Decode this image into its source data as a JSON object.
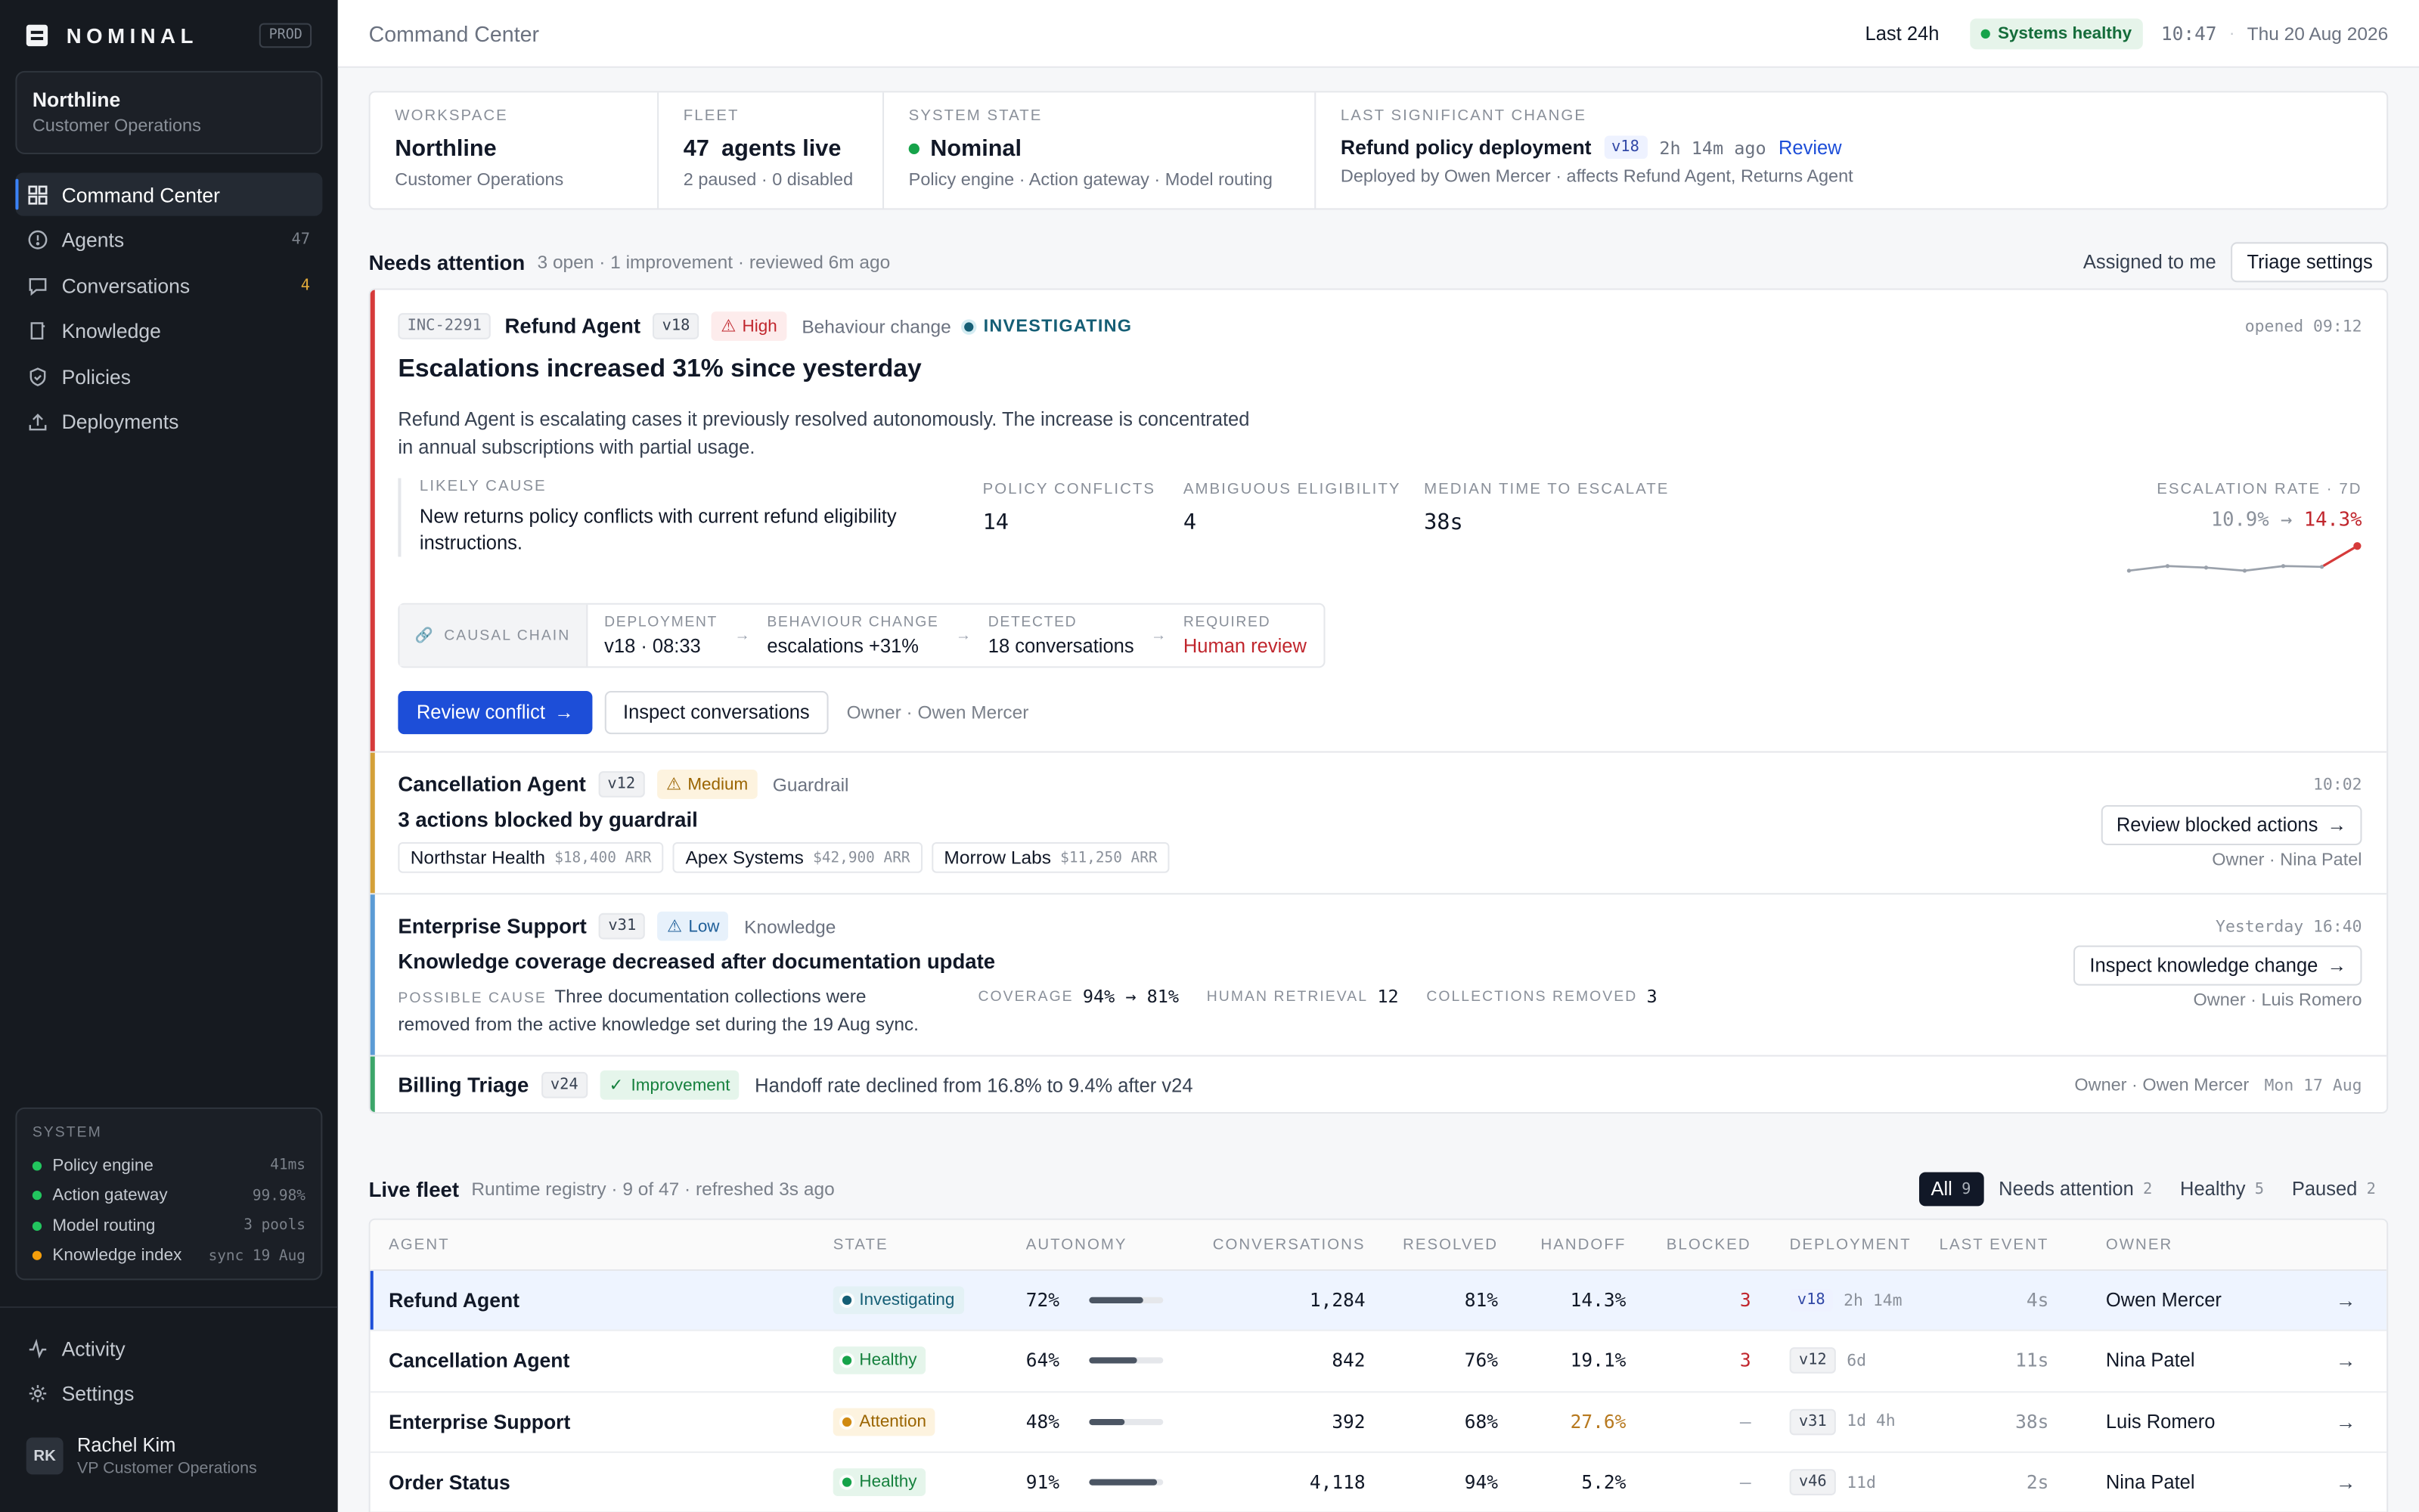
{
  "brand": {
    "name": "NOMINAL",
    "env": "PROD"
  },
  "workspace_card": {
    "name": "Northline",
    "sub": "Customer Operations"
  },
  "nav": [
    {
      "label": "Command Center",
      "icon": "grid-icon",
      "count": ""
    },
    {
      "label": "Agents",
      "icon": "agent-hex-icon",
      "count": "47"
    },
    {
      "label": "Conversations",
      "icon": "chat-icon",
      "count": "4"
    },
    {
      "label": "Knowledge",
      "icon": "book-icon",
      "count": ""
    },
    {
      "label": "Policies",
      "icon": "shield-icon",
      "count": ""
    },
    {
      "label": "Deployments",
      "icon": "upload-icon",
      "count": ""
    }
  ],
  "system": {
    "title": "SYSTEM",
    "rows": [
      {
        "label": "Policy engine",
        "value": "41ms",
        "color": "#22c55e"
      },
      {
        "label": "Action gateway",
        "value": "99.98%",
        "color": "#22c55e"
      },
      {
        "label": "Model routing",
        "value": "3 pools",
        "color": "#22c55e"
      },
      {
        "label": "Knowledge index",
        "value": "sync 19 Aug",
        "color": "#f59e0b"
      }
    ]
  },
  "side_bottom": {
    "activity": "Activity",
    "settings": "Settings"
  },
  "user": {
    "initials": "RK",
    "name": "Rachel Kim",
    "role": "VP Customer Operations"
  },
  "topbar": {
    "title": "Command Center",
    "range": "Last 24h",
    "health": "Systems healthy",
    "time": "10:47",
    "sep": "·",
    "date": "Thu 20 Aug 2026"
  },
  "summary": {
    "workspace": {
      "label": "WORKSPACE",
      "value": "Northline",
      "sub": "Customer Operations"
    },
    "fleet": {
      "label": "FLEET",
      "count": "47",
      "value": "agents live",
      "sub": "2 paused · 0 disabled"
    },
    "state": {
      "label": "SYSTEM STATE",
      "value": "Nominal",
      "sub": "Policy engine · Action gateway · Model routing"
    },
    "change": {
      "label": "LAST SIGNIFICANT CHANGE",
      "value": "Refund policy deployment",
      "version": "v18",
      "ago": "2h 14m ago",
      "link": "Review",
      "sub": "Deployed by Owen Mercer · affects Refund Agent, Returns Agent"
    }
  },
  "attention": {
    "title": "Needs attention",
    "subtitle": "3 open · 1 improvement · reviewed 6m ago",
    "assigned": "Assigned to me",
    "settings": "Triage settings"
  },
  "incident1": {
    "id": "INC-2291",
    "agent": "Refund Agent",
    "version": "v18",
    "severity": "High",
    "kind": "Behaviour change",
    "status": "INVESTIGATING",
    "opened": "opened 09:12",
    "title": "Escalations increased 31% since yesterday",
    "desc1": "Refund Agent is escalating cases it previously resolved autonomously. The increase is concentrated",
    "desc2": "in annual subscriptions with partial usage.",
    "cause_label": "LIKELY CAUSE",
    "cause1": "New returns policy conflicts with current refund eligibility",
    "cause2": "instructions.",
    "metrics": [
      {
        "label": "POLICY CONFLICTS",
        "value": "14"
      },
      {
        "label": "AMBIGUOUS ELIGIBILITY",
        "value": "4"
      },
      {
        "label": "MEDIAN TIME TO ESCALATE",
        "value": "38s"
      }
    ],
    "rate_label": "ESCALATION RATE · 7D",
    "rate_from": "10.9%",
    "rate_arrow": "→",
    "rate_to": "14.3%",
    "chain_label": "CAUSAL CHAIN",
    "chain": [
      {
        "label": "DEPLOYMENT",
        "value": "v18 · 08:33"
      },
      {
        "label": "BEHAVIOUR CHANGE",
        "value": "escalations +31%"
      },
      {
        "label": "DETECTED",
        "value": "18 conversations"
      },
      {
        "label": "REQUIRED",
        "value": "Human review"
      }
    ],
    "primary": "Review conflict",
    "secondary": "Inspect conversations",
    "owner": "Owner · Owen Mercer"
  },
  "incident2": {
    "agent": "Cancellation Agent",
    "version": "v12",
    "severity": "Medium",
    "kind": "Guardrail",
    "opened": "10:02",
    "title": "3 actions blocked by guardrail",
    "customers": [
      {
        "name": "Northstar Health",
        "arr": "$18,400 ARR"
      },
      {
        "name": "Apex Systems",
        "arr": "$42,900 ARR"
      },
      {
        "name": "Morrow Labs",
        "arr": "$11,250 ARR"
      }
    ],
    "action": "Review blocked actions",
    "owner": "Owner · Nina Patel"
  },
  "incident3": {
    "agent": "Enterprise Support",
    "version": "v31",
    "severity": "Low",
    "kind": "Knowledge",
    "opened": "Yesterday 16:40",
    "title": "Knowledge coverage decreased after documentation update",
    "cause_label": "POSSIBLE CAUSE",
    "cause1": "Three documentation collections were",
    "cause2": "removed from the active knowledge set during the 19 Aug sync.",
    "coverage_label": "COVERAGE",
    "coverage": "94% → 81%",
    "retrieval_label": "HUMAN RETRIEVAL",
    "retrieval": "12",
    "removed_label": "COLLECTIONS REMOVED",
    "removed": "3",
    "action": "Inspect knowledge change",
    "owner": "Owner · Luis Romero"
  },
  "incident4": {
    "agent": "Billing Triage",
    "version": "v24",
    "severity": "Improvement",
    "text": "Handoff rate declined from 16.8% to 9.4% after v24",
    "owner": "Owner · Owen Mercer",
    "date": "Mon 17 Aug"
  },
  "fleet": {
    "title": "Live fleet",
    "subtitle": "Runtime registry · 9 of 47 · refreshed 3s ago",
    "tabs": [
      {
        "label": "All",
        "count": "9"
      },
      {
        "label": "Needs attention",
        "count": "2"
      },
      {
        "label": "Healthy",
        "count": "5"
      },
      {
        "label": "Paused",
        "count": "2"
      }
    ],
    "columns": [
      "AGENT",
      "STATE",
      "AUTONOMY",
      "CONVERSATIONS",
      "RESOLVED",
      "HANDOFF",
      "BLOCKED",
      "DEPLOYMENT",
      "LAST EVENT",
      "OWNER"
    ],
    "rows": [
      {
        "agent": "Refund Agent",
        "state": "Investigating",
        "autonomy": "72%",
        "autonomy_frac": 0.72,
        "conversations": "1,284",
        "resolved": "81%",
        "handoff": "14.3%",
        "blocked": "3",
        "version": "v18",
        "ago": "2h 14m",
        "last": "4s",
        "owner": "Owen Mercer",
        "go": "→"
      },
      {
        "agent": "Cancellation Agent",
        "state": "Healthy",
        "autonomy": "64%",
        "autonomy_frac": 0.64,
        "conversations": "842",
        "resolved": "76%",
        "handoff": "19.1%",
        "blocked": "3",
        "version": "v12",
        "ago": "6d",
        "last": "11s",
        "owner": "Nina Patel",
        "go": "→"
      },
      {
        "agent": "Enterprise Support",
        "state": "Attention",
        "autonomy": "48%",
        "autonomy_frac": 0.48,
        "conversations": "392",
        "resolved": "68%",
        "handoff": "27.6%",
        "blocked": "—",
        "version": "v31",
        "ago": "1d 4h",
        "last": "38s",
        "owner": "Luis Romero",
        "go": "→"
      },
      {
        "agent": "Order Status",
        "state": "Healthy",
        "autonomy": "91%",
        "autonomy_frac": 0.91,
        "conversations": "4,118",
        "resolved": "94%",
        "handoff": "5.2%",
        "blocked": "—",
        "version": "v46",
        "ago": "11d",
        "last": "2s",
        "owner": "Nina Patel",
        "go": "→"
      }
    ]
  },
  "colors": {
    "accent": "#1d4ed8",
    "danger": "#c0262d",
    "warning": "#d4a038",
    "info": "#5b9bd5",
    "success": "#3ca66a"
  }
}
